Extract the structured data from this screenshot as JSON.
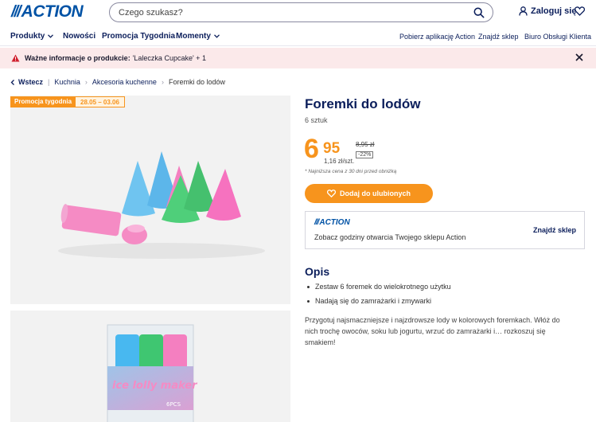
{
  "header": {
    "logo": "ACTION",
    "search_placeholder": "Czego szukasz?",
    "login_label": "Zaloguj się"
  },
  "nav": {
    "left": [
      "Produkty",
      "Nowości",
      "Promocja Tygodnia",
      "Momenty"
    ],
    "right": [
      "Pobierz aplikację Action",
      "Znajdź sklep",
      "Biuro Obsługi Klienta"
    ]
  },
  "notice": {
    "bold": "Ważne informacje o produkcie:",
    "text": "'Laleczka Cupcake' + 1"
  },
  "breadcrumb": {
    "back": "Wstecz",
    "items": [
      "Kuchnia",
      "Akcesoria kuchenne",
      "Foremki do lodów"
    ]
  },
  "promo": {
    "label": "Promocja tygodnia",
    "dates": "28.05 – 03.06"
  },
  "product": {
    "title": "Foremki do lodów",
    "pieces": "6 sztuk",
    "price_whole": "6",
    "price_cents": "95",
    "unit_price": "1,16 zł/szt.",
    "old_price": "8,95 zł",
    "discount": "-22%",
    "lowest_note": "* Najniższa cena z 30 dni przed obniżką",
    "fav_button": "Dodaj do ulubionych"
  },
  "store": {
    "logo": "ACTION",
    "text": "Zobacz godziny otwarcia Twojego sklepu Action",
    "link": "Znajdź sklep"
  },
  "description": {
    "title": "Opis",
    "bullets": [
      "Zestaw 6 foremek do wielokrotnego użytku",
      "Nadają się do zamrażarki i zmywarki"
    ],
    "text": "Przygotuj najsmaczniejsze i najzdrowsze lody w kolorowych foremkach. Włóż do nich trochę owoców, soku lub jogurtu, wrzuć do zamrażarki i… rozkoszuj się smakiem!"
  },
  "packaging": {
    "brand_text": "ice lolly maker",
    "count_text": "6PCS"
  },
  "colors": {
    "brand_blue": "#0052a5",
    "navy": "#0b1e5b",
    "orange": "#f7941d",
    "notice_bg": "#fbe9ea"
  }
}
